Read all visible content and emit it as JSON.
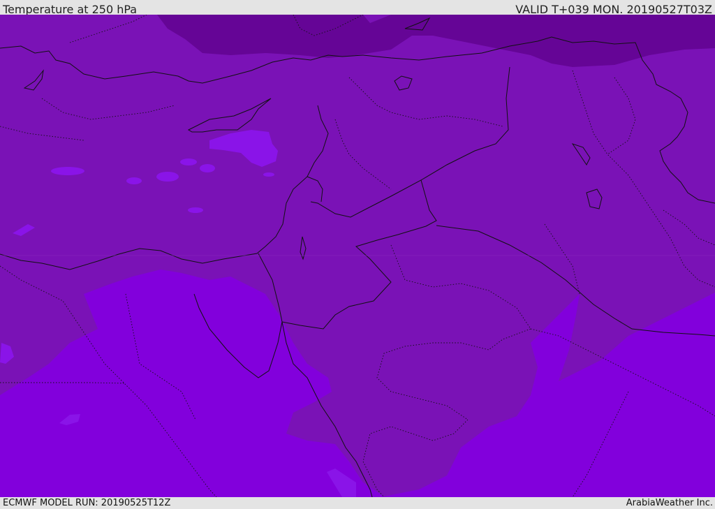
{
  "header": {
    "title": "Temperature at 250 hPa",
    "valid": "VALID T+039 MON. 20190527T03Z"
  },
  "footer": {
    "model_run": "ECMWF MODEL RUN: 20190525T12Z",
    "provider": "ArabiaWeather Inc."
  },
  "map": {
    "colors": {
      "cold_band": "#650596",
      "mid_band": "#7a12b6",
      "warm_band": "#8200dc",
      "patch": "#8a14e8",
      "border": "#111111"
    }
  }
}
